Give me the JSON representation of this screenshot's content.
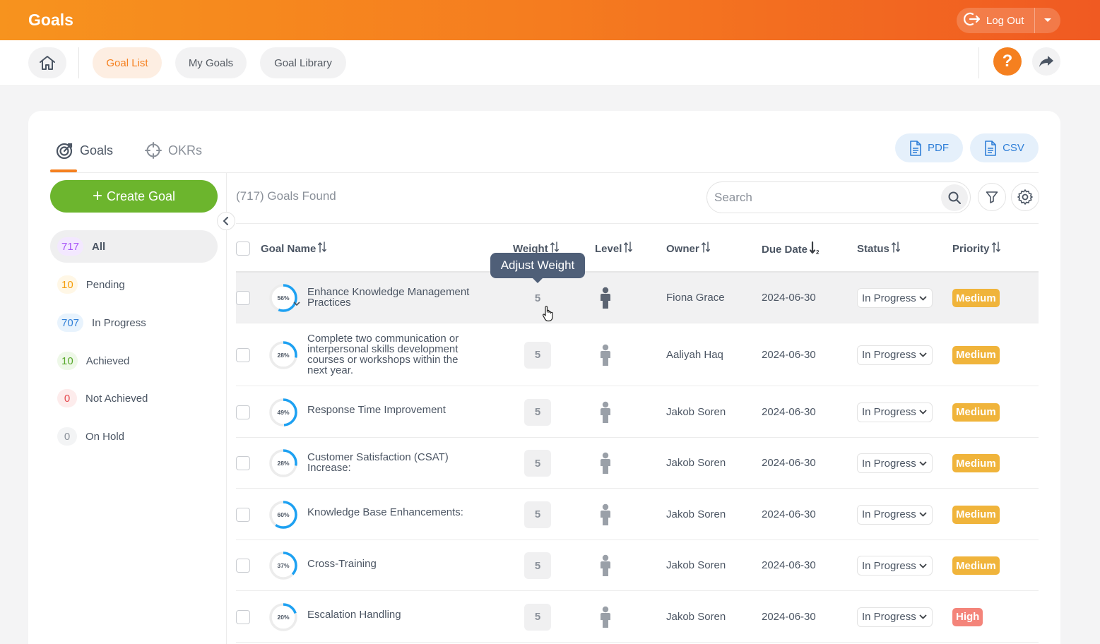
{
  "header": {
    "app_title": "Goals",
    "logout_label": "Log Out"
  },
  "nav": {
    "tabs": [
      {
        "label": "Goal List",
        "active": true
      },
      {
        "label": "My Goals",
        "active": false
      },
      {
        "label": "Goal Library",
        "active": false
      }
    ],
    "help_label": "?"
  },
  "view_tabs": [
    {
      "label": "Goals",
      "active": true
    },
    {
      "label": "OKRs",
      "active": false
    }
  ],
  "export": {
    "pdf_label": "PDF",
    "csv_label": "CSV"
  },
  "sidebar": {
    "create_label": "Create Goal",
    "filters": [
      {
        "count": "717",
        "label": "All",
        "active": true,
        "color": "#a855f7",
        "bg": "#f3e8ff"
      },
      {
        "count": "10",
        "label": "Pending",
        "active": false,
        "color": "#f59e0b",
        "bg": "#fff7e6"
      },
      {
        "count": "707",
        "label": "In Progress",
        "active": false,
        "color": "#2f7fd8",
        "bg": "#e8f3fd"
      },
      {
        "count": "10",
        "label": "Achieved",
        "active": false,
        "color": "#57a82b",
        "bg": "#eef8e8"
      },
      {
        "count": "0",
        "label": "Not Achieved",
        "active": false,
        "color": "#e5484d",
        "bg": "#fdecec"
      },
      {
        "count": "0",
        "label": "On Hold",
        "active": false,
        "color": "#8a9099",
        "bg": "#f3f4f5"
      }
    ]
  },
  "toolbar": {
    "found_text": "(717) Goals Found",
    "search_placeholder": "Search"
  },
  "table": {
    "columns": [
      "Goal Name",
      "Weight",
      "Level",
      "Owner",
      "Due Date",
      "Status",
      "Priority"
    ],
    "tooltip": "Adjust Weight",
    "rows": [
      {
        "progress_label": "56%",
        "progress": 0.56,
        "name": "Enhance Knowledge Management Practices",
        "weight": "5",
        "owner": "Fiona Grace",
        "due": "2024-06-30",
        "status": "In Progress",
        "priority": "Medium"
      },
      {
        "progress_label": "28%",
        "progress": 0.28,
        "name": "Complete two communication or interpersonal skills development courses or workshops within the next year.",
        "weight": "5",
        "owner": "Aaliyah Haq",
        "due": "2024-06-30",
        "status": "In Progress",
        "priority": "Medium"
      },
      {
        "progress_label": "49%",
        "progress": 0.49,
        "name": "Response Time Improvement",
        "weight": "5",
        "owner": "Jakob Soren",
        "due": "2024-06-30",
        "status": "In Progress",
        "priority": "Medium"
      },
      {
        "progress_label": "28%",
        "progress": 0.28,
        "name": "Customer Satisfaction (CSAT) Increase:",
        "weight": "5",
        "owner": "Jakob Soren",
        "due": "2024-06-30",
        "status": "In Progress",
        "priority": "Medium"
      },
      {
        "progress_label": "60%",
        "progress": 0.6,
        "name": "Knowledge Base Enhancements:",
        "weight": "5",
        "owner": "Jakob Soren",
        "due": "2024-06-30",
        "status": "In Progress",
        "priority": "Medium"
      },
      {
        "progress_label": "37%",
        "progress": 0.37,
        "name": "Cross-Training",
        "weight": "5",
        "owner": "Jakob Soren",
        "due": "2024-06-30",
        "status": "In Progress",
        "priority": "Medium"
      },
      {
        "progress_label": "20%",
        "progress": 0.2,
        "name": "Escalation Handling",
        "weight": "5",
        "owner": "Jakob Soren",
        "due": "2024-06-30",
        "status": "In Progress",
        "priority": "High"
      }
    ]
  },
  "colors": {
    "accent": "#f5801f",
    "create_green": "#6cb52d",
    "ring_blue": "#1da1f2",
    "priority_medium": "#f0b43b",
    "priority_high": "#f4847a"
  }
}
